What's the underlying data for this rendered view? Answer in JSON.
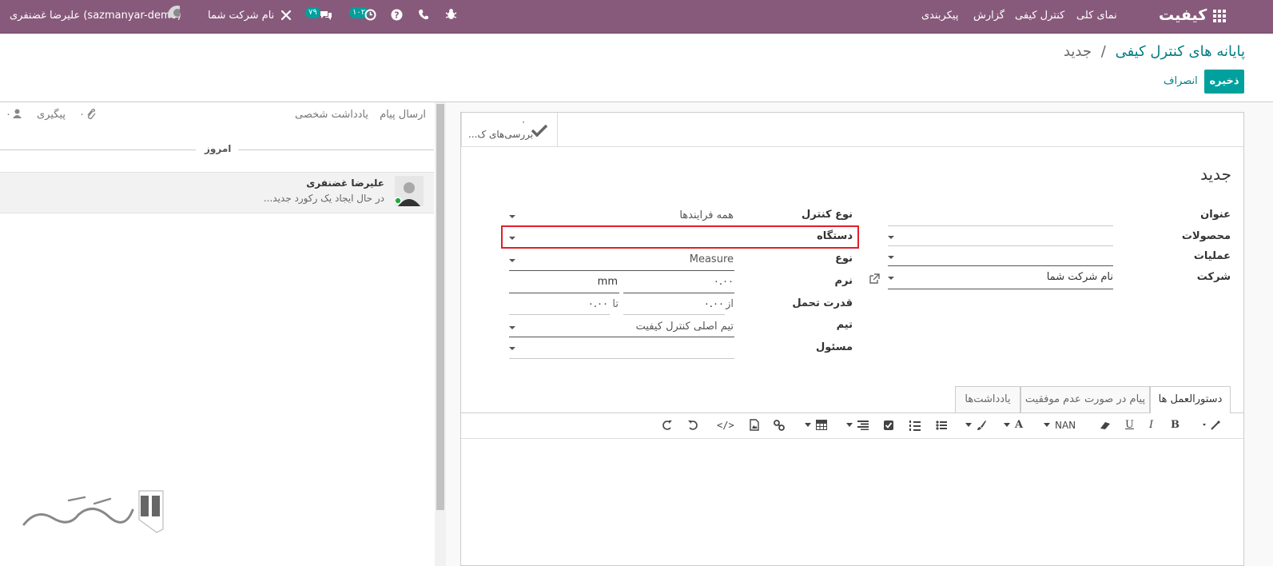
{
  "navbar": {
    "brand": "کیفیت",
    "menu": [
      "نمای کلی",
      "کنترل کیفی",
      "گزارش",
      "پیکربندی"
    ],
    "user": "علیرضا غضنفری (sazmanyar-demo)",
    "company": "نام شرکت شما",
    "messages_count": "۷۹",
    "activities_count": "۱۰۲"
  },
  "breadcrumb": {
    "parent": "پایانه های کنترل کیفی",
    "separator": "/",
    "current": "جدید"
  },
  "buttons": {
    "save": "ذخیره",
    "discard": "انصراف"
  },
  "smart_button": {
    "count": "۰",
    "label": "بررسی‌های ک..."
  },
  "form": {
    "title": "جدید",
    "left": {
      "title_label": "عنوان",
      "products_label": "محصولات",
      "operations_label": "عملیات",
      "company_label": "شرکت",
      "company_value": "نام شرکت شما"
    },
    "right": {
      "control_type_label": "نوع کنترل",
      "control_type_value": "همه فرایندها",
      "device_label": "دستگاه",
      "type_label": "نوع",
      "type_value": "Measure",
      "norm_label": "نرم",
      "norm_value": "۰.۰۰",
      "norm_unit": "mm",
      "tolerance_label": "قدرت تحمل",
      "from_label": "از",
      "from_value": "۰.۰۰",
      "to_label": "تا",
      "to_value": "۰.۰۰",
      "team_label": "تیم",
      "team_value": "تیم اصلی کنترل کیفیت",
      "responsible_label": "مسئول"
    },
    "tabs": [
      "دستورالعمل ها",
      "پیام در صورت عدم موفقیت",
      "یادداشت‌ها"
    ],
    "editor": {
      "font_size": "NAN"
    }
  },
  "chatter": {
    "send_message": "ارسال پیام",
    "log_note": "یادداشت شخصی",
    "follow": "پیگیری",
    "attachments_count": "۰",
    "followers_count": "۰",
    "today": "امروز",
    "message_author": "علیرضا غضنفری",
    "message_body": "در حال ایجاد یک رکورد جدید..."
  },
  "colors": {
    "navbar": "#875a7b",
    "primary": "#00a09d",
    "link": "#017e84",
    "highlight_box": "#e0202a"
  }
}
